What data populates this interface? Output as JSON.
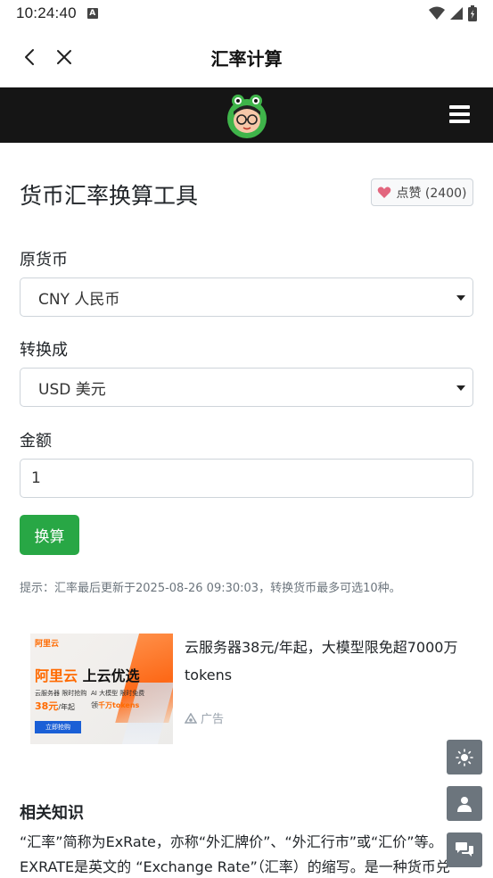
{
  "status_bar": {
    "time": "10:24:40",
    "notification_icon": "A"
  },
  "app_bar": {
    "title": "汇率计算"
  },
  "page": {
    "heading": "货币汇率换算工具",
    "like_label": "点赞 (2400)"
  },
  "form": {
    "source_label": "原货币",
    "source_value": "CNY 人民币",
    "target_label": "转换成",
    "target_value": "USD 美元",
    "amount_label": "金额",
    "amount_value": "1",
    "convert_label": "换算",
    "hint": "提示：汇率最后更新于2025-08-26 09:30:03，转换货币最多可选10种。"
  },
  "ad": {
    "image_logo": "阿里云",
    "image_headline_a": "阿里云",
    "image_headline_b": "上云优选",
    "image_line_1": "云服务器 限时抢购",
    "image_price": "38元",
    "image_price_suffix": "/年起",
    "image_line_2": "AI 大模型 限时免费",
    "image_tokens_prefix": "领",
    "image_tokens": "千万tokens",
    "image_cta": "立即抢购",
    "text": "云服务器38元/年起，大模型限免超7000万 tokens",
    "tag": "广告"
  },
  "knowledge": {
    "title": "相关知识",
    "body": "“汇率”简称为ExRate，亦称“外汇牌价”、“外汇行市”或“汇价”等。EXRATE是英文的 “Exchange Rate”（汇率）的缩写。是一种货币兑"
  },
  "icons": {
    "back": "chevron-left-icon",
    "close": "close-icon",
    "menu": "hamburger-menu-icon",
    "theme": "sun-icon",
    "user": "user-icon",
    "chat": "chat-icon"
  },
  "colors": {
    "nav_bg": "#151515",
    "primary_button": "#28a745",
    "float_button": "#6c757d",
    "heart": "#e2667e",
    "ad_orange": "#ff6a00"
  }
}
